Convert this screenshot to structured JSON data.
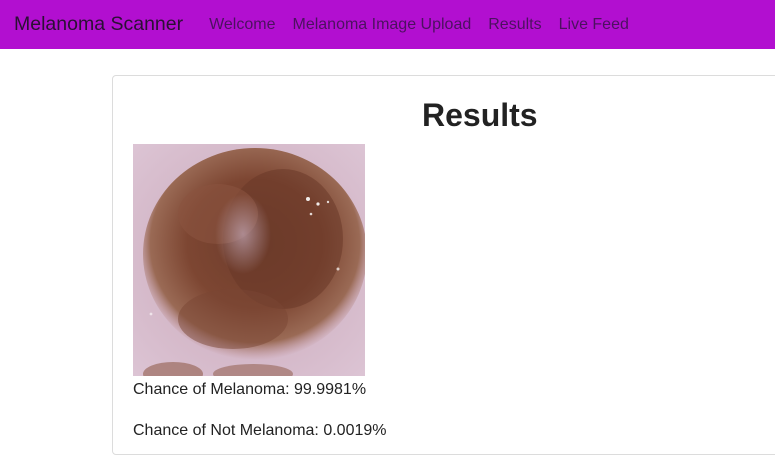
{
  "navbar": {
    "brand": "Melanoma Scanner",
    "links": [
      "Welcome",
      "Melanoma Image Upload",
      "Results",
      "Live Feed"
    ],
    "background": "#b20fd0"
  },
  "main": {
    "title": "Results",
    "image_subject": "skin-lesion-photo",
    "results": {
      "melanoma_label": "Chance of Melanoma: 99.9981%",
      "not_melanoma_label": "Chance of Not Melanoma: 0.0019%"
    }
  }
}
